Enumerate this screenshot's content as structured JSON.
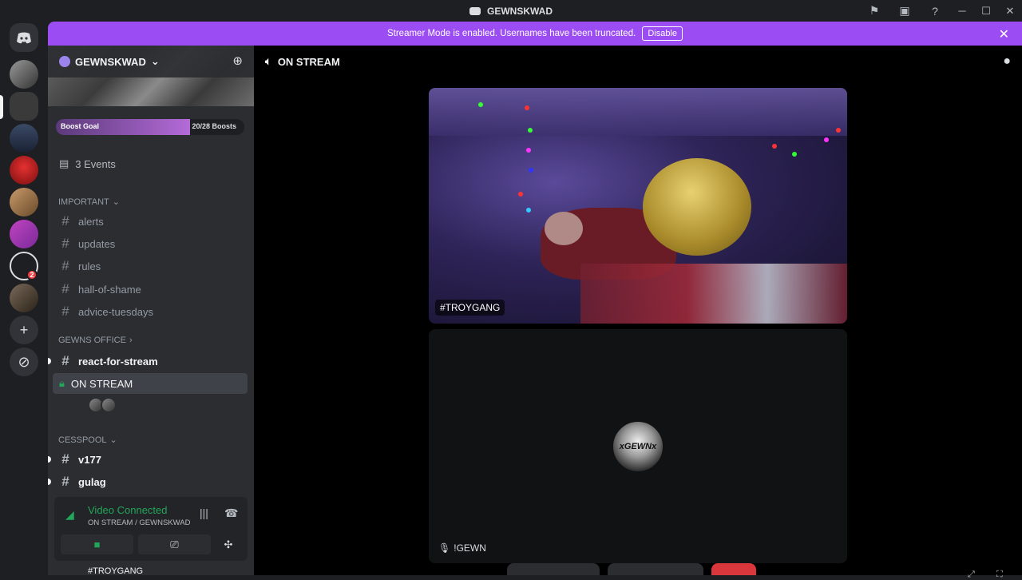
{
  "window": {
    "title": "GEWNSKWAD",
    "icons": [
      "flag-icon",
      "inbox-icon",
      "help-icon"
    ],
    "controls": [
      "─",
      "☐",
      "✕"
    ]
  },
  "banner": {
    "text": "Streamer Mode is enabled. Usernames have been truncated.",
    "disable_label": "Disable",
    "color": "#9b4df3"
  },
  "server": {
    "name": "GEWNSKWAD",
    "boost": {
      "label": "Boost Goal",
      "count": "20/28 Boosts",
      "progress": 0.714
    },
    "events": "3 Events"
  },
  "categories": {
    "important": "IMPORTANT",
    "gewns_office": "GEWNS OFFICE",
    "cesspool": "CESSPOOL"
  },
  "channels": {
    "alerts": "alerts",
    "updates": "updates",
    "rules": "rules",
    "hall_of_shame": "hall-of-shame",
    "advice_tuesdays": "advice-tuesdays",
    "react_for_stream": "react-for-stream",
    "on_stream": "ON STREAM",
    "v177": "v177",
    "gulag": "gulag"
  },
  "voice": {
    "status": "Video Connected",
    "location": "ON STREAM / GEWNSKWAD"
  },
  "user_panel": {
    "name": "#TROYGANG"
  },
  "main": {
    "channel": "ON STREAM",
    "stream_label": "#TROYGANG",
    "user_tile_label": "!GEWN",
    "avatar_text": "xGEWNx"
  },
  "guild_badge": "2"
}
